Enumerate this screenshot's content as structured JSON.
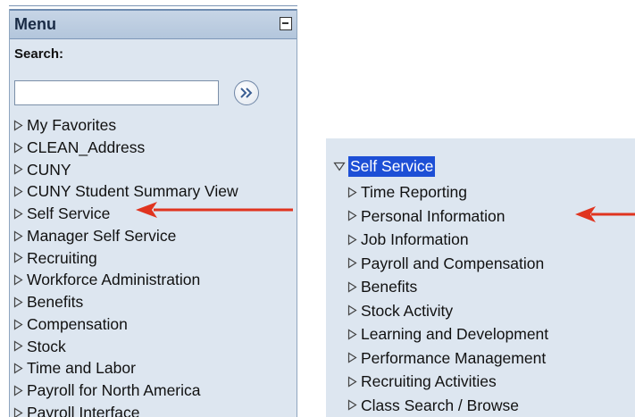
{
  "left_menu": {
    "title": "Menu",
    "search_label": "Search:",
    "search_value": "",
    "search_placeholder": "",
    "items": [
      {
        "label": "My Favorites"
      },
      {
        "label": "CLEAN_Address"
      },
      {
        "label": "CUNY"
      },
      {
        "label": "CUNY Student Summary View"
      },
      {
        "label": "Self Service"
      },
      {
        "label": "Manager Self Service"
      },
      {
        "label": "Recruiting"
      },
      {
        "label": "Workforce Administration"
      },
      {
        "label": "Benefits"
      },
      {
        "label": "Compensation"
      },
      {
        "label": "Stock"
      },
      {
        "label": "Time and Labor"
      },
      {
        "label": "Payroll for North America"
      },
      {
        "label": "Payroll Interface"
      }
    ]
  },
  "right_menu": {
    "expanded_item": "Self Service",
    "sub_items": [
      {
        "label": "Time Reporting"
      },
      {
        "label": "Personal Information"
      },
      {
        "label": "Job Information"
      },
      {
        "label": "Payroll and Compensation"
      },
      {
        "label": "Benefits"
      },
      {
        "label": "Stock Activity"
      },
      {
        "label": "Learning and Development"
      },
      {
        "label": "Performance Management"
      },
      {
        "label": "Recruiting Activities"
      },
      {
        "label": "Class Search / Browse"
      }
    ]
  },
  "colors": {
    "panel_bg": "#dde6f0",
    "highlight": "#1d4fd6",
    "annotation_arrow": "#e0341f"
  },
  "icons": {
    "collapse": "collapse-minus-icon",
    "search_go": "double-chevron-right-icon",
    "collapsed": "triangle-right-icon",
    "expanded": "triangle-down-icon"
  }
}
